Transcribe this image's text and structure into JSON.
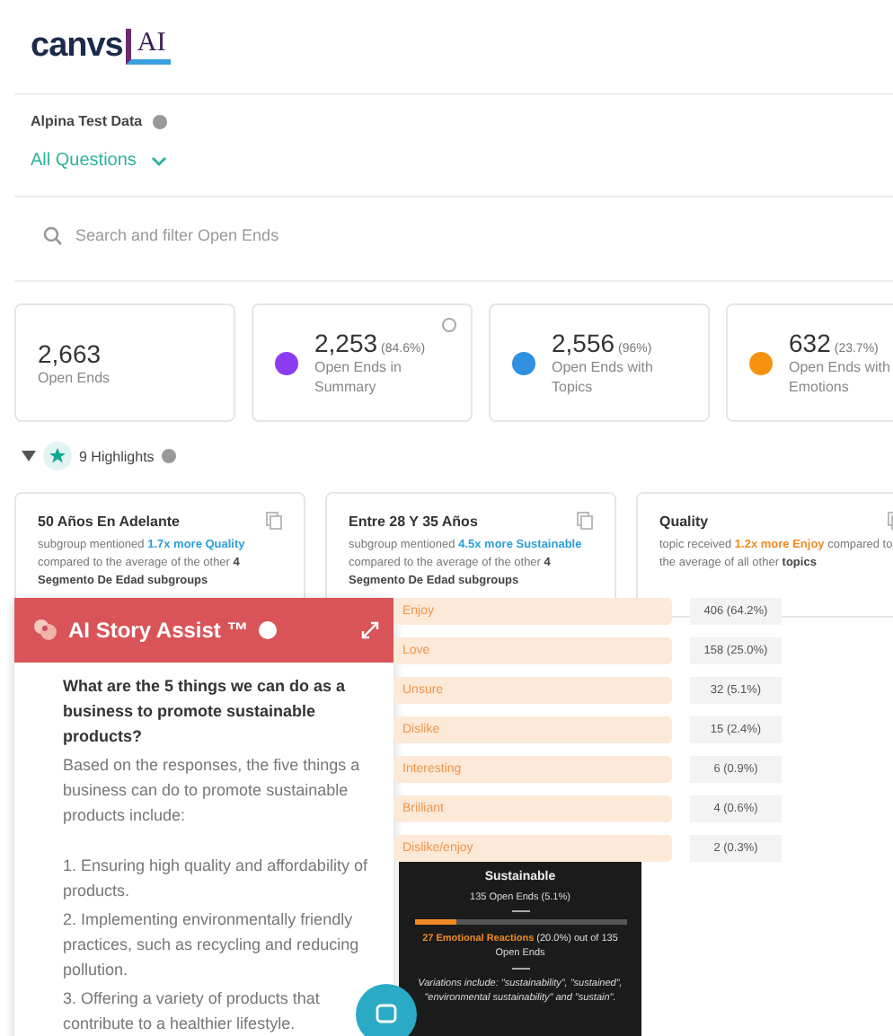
{
  "logo": {
    "wordmark": "canvs",
    "badge": "AI"
  },
  "dataset": {
    "name": "Alpina Test Data"
  },
  "question_filter": {
    "label": "All Questions",
    "expanded": false
  },
  "search": {
    "placeholder": "Search and filter Open Ends"
  },
  "stats": [
    {
      "kind": "plain",
      "value": "2,663",
      "label": "Open Ends"
    },
    {
      "kind": "summary",
      "value": "2,253",
      "percent": "(84.6%)",
      "label": "Open Ends in Summary"
    },
    {
      "kind": "topics",
      "value": "2,556",
      "percent": "(96%)",
      "label": "Open Ends with Topics"
    },
    {
      "kind": "emotions",
      "value": "632",
      "percent": "(23.7%)",
      "label": "Open Ends with Emotions"
    }
  ],
  "highlights": {
    "expanded": true,
    "label": "9 Highlights",
    "cards": [
      {
        "kind": "subgroup",
        "title": "50 Años En Adelante",
        "segments": [
          {
            "kind": "plain",
            "text": "subgroup mentioned "
          },
          {
            "kind": "finding",
            "text": "1.7x more Quality"
          },
          {
            "kind": "plain",
            "text": " compared to the average of the other "
          },
          {
            "kind": "group",
            "text": "4 Segmento De Edad subgroups"
          }
        ]
      },
      {
        "kind": "subgroup",
        "title": "Entre 28 Y 35 Años",
        "segments": [
          {
            "kind": "plain",
            "text": "subgroup mentioned "
          },
          {
            "kind": "finding",
            "text": "4.5x more Sustainable"
          },
          {
            "kind": "plain",
            "text": " compared to the average of the other "
          },
          {
            "kind": "group",
            "text": "4 Segmento De Edad subgroups"
          }
        ]
      },
      {
        "kind": "topic",
        "title": "Quality",
        "segments": [
          {
            "kind": "plain",
            "text": "topic received "
          },
          {
            "kind": "finding",
            "text": "1.2x more Enjoy"
          },
          {
            "kind": "plain",
            "text": " compared to the average of all other "
          },
          {
            "kind": "group",
            "text": "topics"
          }
        ]
      }
    ]
  },
  "story_assist": {
    "title": "AI Story Assist ™",
    "question": "What are the 5 things we can do as a business to promote sustainable products?",
    "answer": [
      "Based on the responses, the five things a business can do to promote sustainable products include:",
      "1. Ensuring high quality and affordability of products.",
      "2. Implementing environmentally friendly practices, such as recycling and reducing pollution.",
      "3. Offering a variety of products that contribute to a healthier lifestyle."
    ]
  },
  "emotions": [
    {
      "label": "Enjoy",
      "count": "406 (64.2%)"
    },
    {
      "label": "Love",
      "count": "158 (25.0%)"
    },
    {
      "label": "Unsure",
      "count": "32 (5.1%)"
    },
    {
      "label": "Dislike",
      "count": "15 (2.4%)"
    },
    {
      "label": "Interesting",
      "count": "6 (0.9%)"
    },
    {
      "label": "Brilliant",
      "count": "4 (0.6%)"
    },
    {
      "label": "Dislike/enjoy",
      "count": "2 (0.3%)"
    }
  ],
  "tooltip": {
    "title": "Sustainable",
    "subtitle": "135 Open Ends (5.1%)",
    "level": 0.2,
    "highlight": "27 Emotional Reactions",
    "highlight_rest": " (20.0%) out of 135 Open Ends",
    "note": "Variations include: \"sustainability\", \"sustained\", \"environmental sustainability\" and \"sustain\"."
  }
}
